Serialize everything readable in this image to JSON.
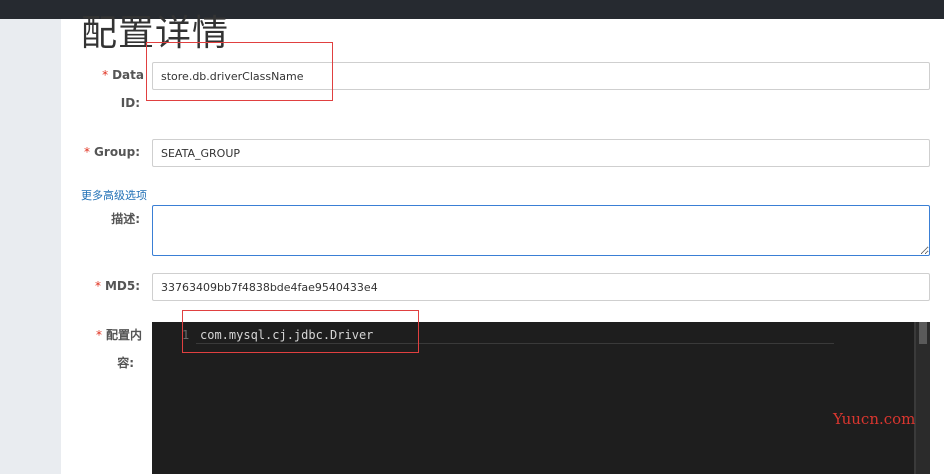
{
  "page": {
    "title": "配置详情"
  },
  "form": {
    "data_id": {
      "required_mark": "*",
      "label_line1": "Data",
      "label_line2": "ID:",
      "value": "store.db.driverClassName"
    },
    "group": {
      "required_mark": "*",
      "label": "Group:",
      "value": "SEATA_GROUP"
    },
    "advanced_link": "更多高级选项",
    "description": {
      "label": "描述:",
      "value": ""
    },
    "md5": {
      "required_mark": "*",
      "label": "MD5:",
      "value": "33763409bb7f4838bde4fae9540433e4"
    },
    "content": {
      "required_mark": "*",
      "label_line1": "配置内",
      "label_line2": "容:",
      "line_number": "1",
      "code": "com.mysql.cj.jdbc.Driver"
    }
  },
  "watermark": "Yuucn.com",
  "colors": {
    "topbar": "#262a30",
    "required": "#e0301e",
    "link": "#1f6fb5",
    "editor_bg": "#1e1e1e",
    "annotation": "#e04040"
  }
}
